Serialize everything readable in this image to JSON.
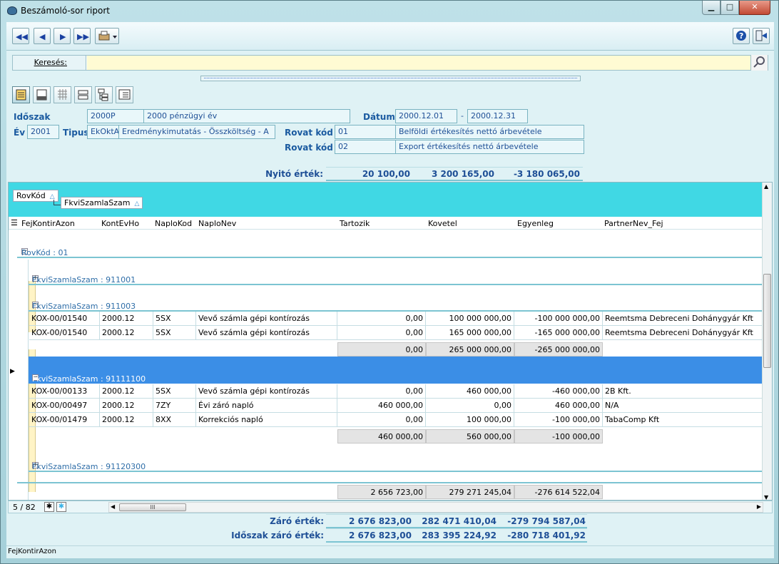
{
  "window": {
    "title": "Beszámoló-sor riport",
    "min": "▁",
    "max": "□",
    "close": "✕"
  },
  "search": {
    "label": "Keresés:",
    "value": ""
  },
  "filters": {
    "idoszak_label": "Időszak",
    "idoszak_code": "2000P",
    "idoszak_name": "2000 pénzügyi év",
    "datum_label": "Dátum",
    "datum_from": "2000.12.01",
    "datum_dash": "-",
    "datum_to": "2000.12.31",
    "ev_label": "Év",
    "ev_value": "2001",
    "tipus_label": "Tipus",
    "tipus_code": "EkOktA",
    "tipus_name": "Eredménykimutatás - Összköltség - A",
    "rovat1_label": "Rovat kód",
    "rovat1_code": "01",
    "rovat1_name": "Belföldi értékesítés nettó árbevétele",
    "rovat2_label": "Rovat kód",
    "rovat2_code": "02",
    "rovat2_name": "Export értékesítés nettó árbevétele"
  },
  "nyito": {
    "label": "Nyitó érték:",
    "v1": "20 100,00",
    "v2": "3 200 165,00",
    "v3": "-3 180 065,00"
  },
  "group_by": {
    "chip1": "RovKód",
    "chip2": "FkviSzamlaSzam",
    "tri": "△"
  },
  "columns": [
    "FejKontirAzon",
    "KontEvHo",
    "NaploKod",
    "NaploNev",
    "Tartozik",
    "Kovetel",
    "Egyenleg",
    "PartnerNev_Fej"
  ],
  "groups": {
    "rovkod": "RovKód : 01",
    "g1": "FkviSzamlaSzam : 911001",
    "g2": "FkviSzamlaSzam : 911003",
    "g3": "FkviSzamlaSzam : 91111100",
    "g4": "FkviSzamlaSzam : 91120300"
  },
  "rows_g2": [
    {
      "azon": "KOX-00/01540",
      "evho": "2000.12",
      "kod": "5SX",
      "nev": "Vevő számla gépi kontírozás",
      "tart": "0,00",
      "kov": "100 000 000,00",
      "egy": "-100 000 000,00",
      "partner": "Reemtsma Debreceni Dohánygyár Kft"
    },
    {
      "azon": "KOX-00/01540",
      "evho": "2000.12",
      "kod": "5SX",
      "nev": "Vevő számla gépi kontírozás",
      "tart": "0,00",
      "kov": "165 000 000,00",
      "egy": "-165 000 000,00",
      "partner": "Reemtsma Debreceni Dohánygyár Kft"
    }
  ],
  "sum_g2": {
    "tart": "0,00",
    "kov": "265 000 000,00",
    "egy": "-265 000 000,00"
  },
  "rows_g3": [
    {
      "azon": "KOX-00/00133",
      "evho": "2000.12",
      "kod": "5SX",
      "nev": "Vevő számla gépi kontírozás",
      "tart": "0,00",
      "kov": "460 000,00",
      "egy": "-460 000,00",
      "partner": "2B Kft."
    },
    {
      "azon": "KOX-00/00497",
      "evho": "2000.12",
      "kod": "7ZY",
      "nev": "Évi záró napló",
      "tart": "460 000,00",
      "kov": "0,00",
      "egy": "460 000,00",
      "partner": "N/A"
    },
    {
      "azon": "KOX-00/01479",
      "evho": "2000.12",
      "kod": "8XX",
      "nev": "Korrekciós napló",
      "tart": "0,00",
      "kov": "100 000,00",
      "egy": "-100 000,00",
      "partner": "TabaComp Kft"
    }
  ],
  "sum_g3": {
    "tart": "460 000,00",
    "kov": "560 000,00",
    "egy": "-100 000,00"
  },
  "grand": {
    "tart": "2 656 723,00",
    "kov": "279 271 245,04",
    "egy": "-276 614 522,04"
  },
  "pager": {
    "text": "5 / 82",
    "hs_thumb": "III"
  },
  "zaro": {
    "label": "Záró érték:",
    "v1": "2 676 823,00",
    "v2": "282 471 410,04",
    "v3": "-279 794 587,04"
  },
  "idoszak_zaro": {
    "label": "Időszak záró érték:",
    "v1": "2 676 823,00",
    "v2": "283 395 224,92",
    "v3": "-280 718 401,92"
  },
  "status": "FejKontirAzon"
}
